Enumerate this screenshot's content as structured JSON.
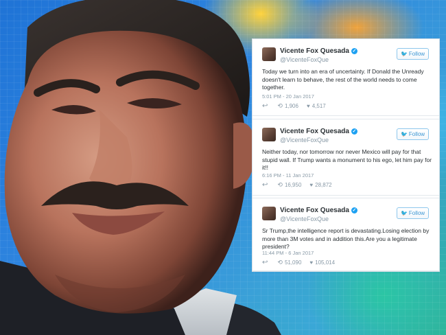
{
  "tweets": [
    {
      "name": "Vicente Fox Quesada",
      "handle": "@VicenteFoxQue",
      "follow_label": "Follow",
      "text": "Today we turn into an era of uncertainty. If Donald the Unready doesn't learn to behave, the rest of the world needs to come together.",
      "timestamp": "5:01 PM - 20 Jan 2017",
      "retweets": "1,906",
      "likes": "4,517"
    },
    {
      "name": "Vicente Fox Quesada",
      "handle": "@VicenteFoxQue",
      "follow_label": "Follow",
      "text": "Neither today, nor tomorrow nor never Mexico will pay for that stupid wall. If Trump wants a monument to his ego, let him pay for it!!",
      "timestamp": "6:16 PM - 11 Jan 2017",
      "retweets": "16,950",
      "likes": "28,872"
    },
    {
      "name": "Vicente Fox Quesada",
      "handle": "@VicenteFoxQue",
      "follow_label": "Follow",
      "text": "Sr Trump,the intelligence report is devastating.Losing election by more than 3M votes and in addition this.Are you a legitimate president?",
      "timestamp": "11:44 PM - 6 Jan 2017",
      "retweets": "51,090",
      "likes": "105,014"
    }
  ],
  "icons": {
    "verified": "verified-badge-icon",
    "bird": "twitter-bird-icon",
    "reply": "reply-icon",
    "retweet": "retweet-icon",
    "like": "heart-icon"
  },
  "colors": {
    "twitter_blue": "#1da1f2",
    "text": "#292f33",
    "muted": "#8899a6"
  }
}
